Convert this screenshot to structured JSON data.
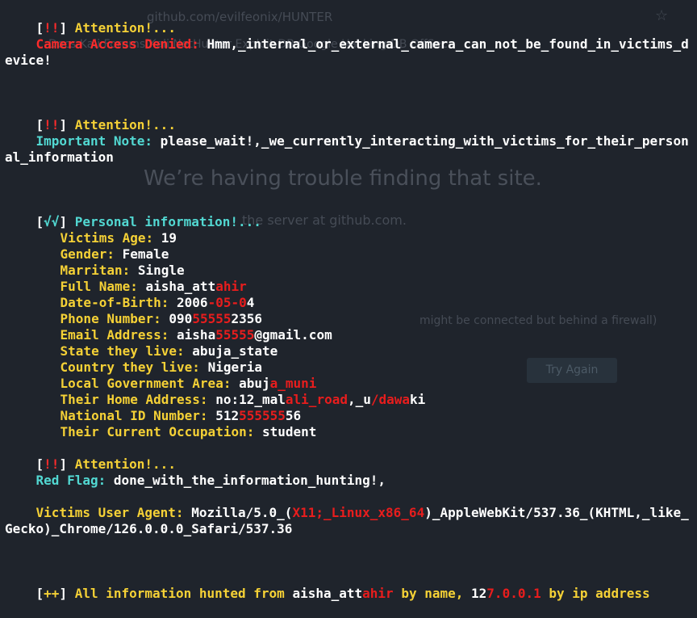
{
  "background": {
    "url": "github.com/evilfeonix/HUNTER",
    "star_icon": "☆",
    "bookmarks": "Docs    Kali Forums    Kali NetHunter    Exploit-DB    Google Hacking DB      OffSec",
    "heading": "We’re having trouble finding that site.",
    "subtext": "the server at github.com.",
    "firewall_note": "might be connected but behind a firewall)",
    "try_again": "Try Again"
  },
  "colors": {
    "bracket": "#ffffff",
    "attention": "#f5d136",
    "error_label": "#ff2b2b",
    "info_label": "#52d8d2",
    "field_label": "#f5d136",
    "value": "#ffffff",
    "redaction": "#e81d1d"
  },
  "terminal": {
    "attention1": {
      "icon": "!!",
      "title": "Attention!..."
    },
    "camera": {
      "label": "Camera Access Denied:",
      "message": "Hmm,_internal_or_external_camera_can_not_be_found_in_victims_device!"
    },
    "attention2": {
      "icon": "!!",
      "title": "Attention!..."
    },
    "note": {
      "label": "Important Note:",
      "message": "please_wait!,_we_currently_interacting_with_victims_for_their_personal_information"
    },
    "personal": {
      "icon": "√√",
      "title": "Personal information!..."
    },
    "fields": [
      {
        "label": "Victims Age:",
        "value": "19",
        "redacted": ""
      },
      {
        "label": "Gender:",
        "value": "Female",
        "redacted": ""
      },
      {
        "label": "Marritan:",
        "value": "Single",
        "redacted": ""
      },
      {
        "label": "Full Name:",
        "value": "aisha_att",
        "redacted": "ahir"
      },
      {
        "label": "Date-of-Birth:",
        "value": "2006",
        "redacted": "-05-0",
        "value_after": "4"
      },
      {
        "label": "Phone Number:",
        "value": "090",
        "redacted": "55555",
        "value_after": "2356"
      },
      {
        "label": "Email Address:",
        "value": "aisha",
        "redacted": "55555",
        "value_after": "@gmail.com"
      },
      {
        "label": "State they live:",
        "value": "abuja_state",
        "redacted": ""
      },
      {
        "label": "Country they live:",
        "value": "Nigeria",
        "redacted": ""
      },
      {
        "label": "Local Government Area:",
        "value": "abuj",
        "redacted": "a_muni"
      },
      {
        "label": "Their Home Address:",
        "value": "no:12_mal",
        "redacted": "ali_road",
        "value_after": ",_u",
        "redacted2": "/dawa",
        "value_after2": "ki"
      },
      {
        "label": "National ID Number:",
        "value": "512",
        "redacted": "555555",
        "value_after": "56"
      },
      {
        "label": "Their Current Occupation:",
        "value": "student",
        "redacted": ""
      }
    ],
    "attention3": {
      "icon": "!!",
      "title": "Attention!..."
    },
    "flag": {
      "label": "Red Flag:",
      "message": "done_with_the_information_hunting!,"
    },
    "agent": {
      "label": "Victims User Agent:",
      "value_start": "Mozilla/5.0_(",
      "redacted": "X11;_Linux_x86_64",
      "value_end": ")_AppleWebKit/537.36_(KHTML,_like_Gecko)_Chrome/126.0.0.0_Safari/537.36"
    },
    "summary": {
      "icon": "++",
      "text_start": "All information hunted from",
      "name_visible": "aisha_att",
      "name_redacted": "ahir",
      "text_mid": "by name,",
      "ip_visible": "12",
      "ip_redacted": "7.0.0.1",
      "text_end": "by ip address"
    }
  }
}
